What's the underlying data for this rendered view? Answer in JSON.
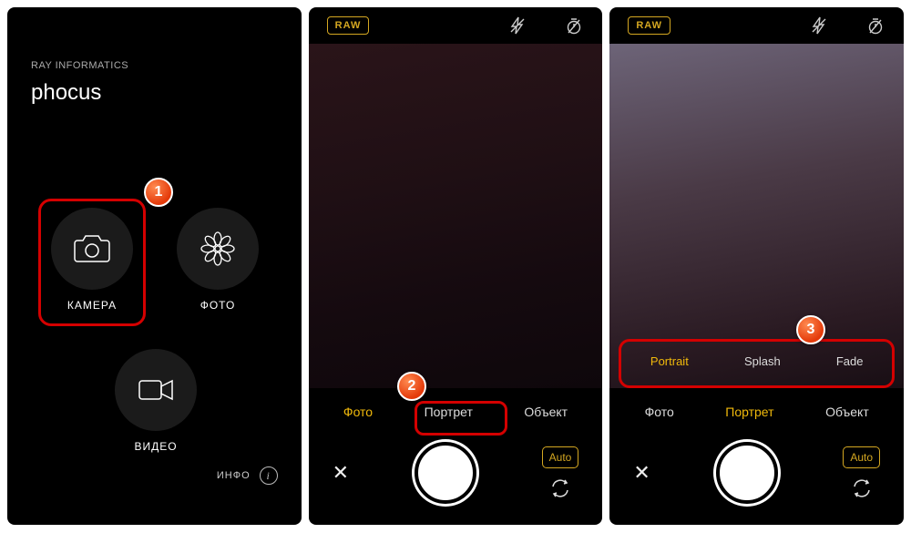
{
  "developer": "RAY INFORMATICS",
  "app_name": "phocus",
  "menu": {
    "camera": "КАМЕРА",
    "photo": "ФОТО",
    "video": "ВИДЕО"
  },
  "info_label": "ИНФО",
  "raw_label": "RAW",
  "modes": {
    "photo": "Фото",
    "portrait": "Портрет",
    "object": "Объект"
  },
  "submodes": {
    "portrait": "Portrait",
    "splash": "Splash",
    "fade": "Fade"
  },
  "auto_label": "Auto",
  "callouts": {
    "c1": "1",
    "c2": "2",
    "c3": "3"
  },
  "colors": {
    "accent": "#f0b90b",
    "highlight": "#d40000"
  }
}
